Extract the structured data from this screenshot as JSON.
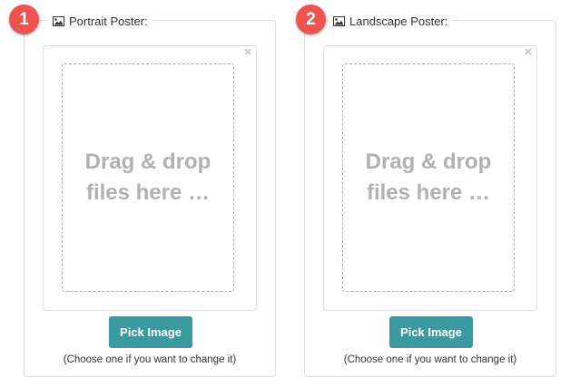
{
  "colors": {
    "badge": "#ef5350",
    "button": "#3a9aa0",
    "drop_text": "#b1b1b1",
    "border": "#dddddd"
  },
  "panels": [
    {
      "badge": "1",
      "title": "Portrait Poster:",
      "title_icon": "image-icon",
      "remove_icon": "close-icon",
      "drop_line1": "Drag & drop",
      "drop_line2": "files here …",
      "button_label": "Pick Image",
      "hint": "(Choose one if you want to change it)"
    },
    {
      "badge": "2",
      "title": "Landscape Poster:",
      "title_icon": "image-icon",
      "remove_icon": "close-icon",
      "drop_line1": "Drag & drop",
      "drop_line2": "files here …",
      "button_label": "Pick Image",
      "hint": "(Choose one if you want to change it)"
    }
  ]
}
